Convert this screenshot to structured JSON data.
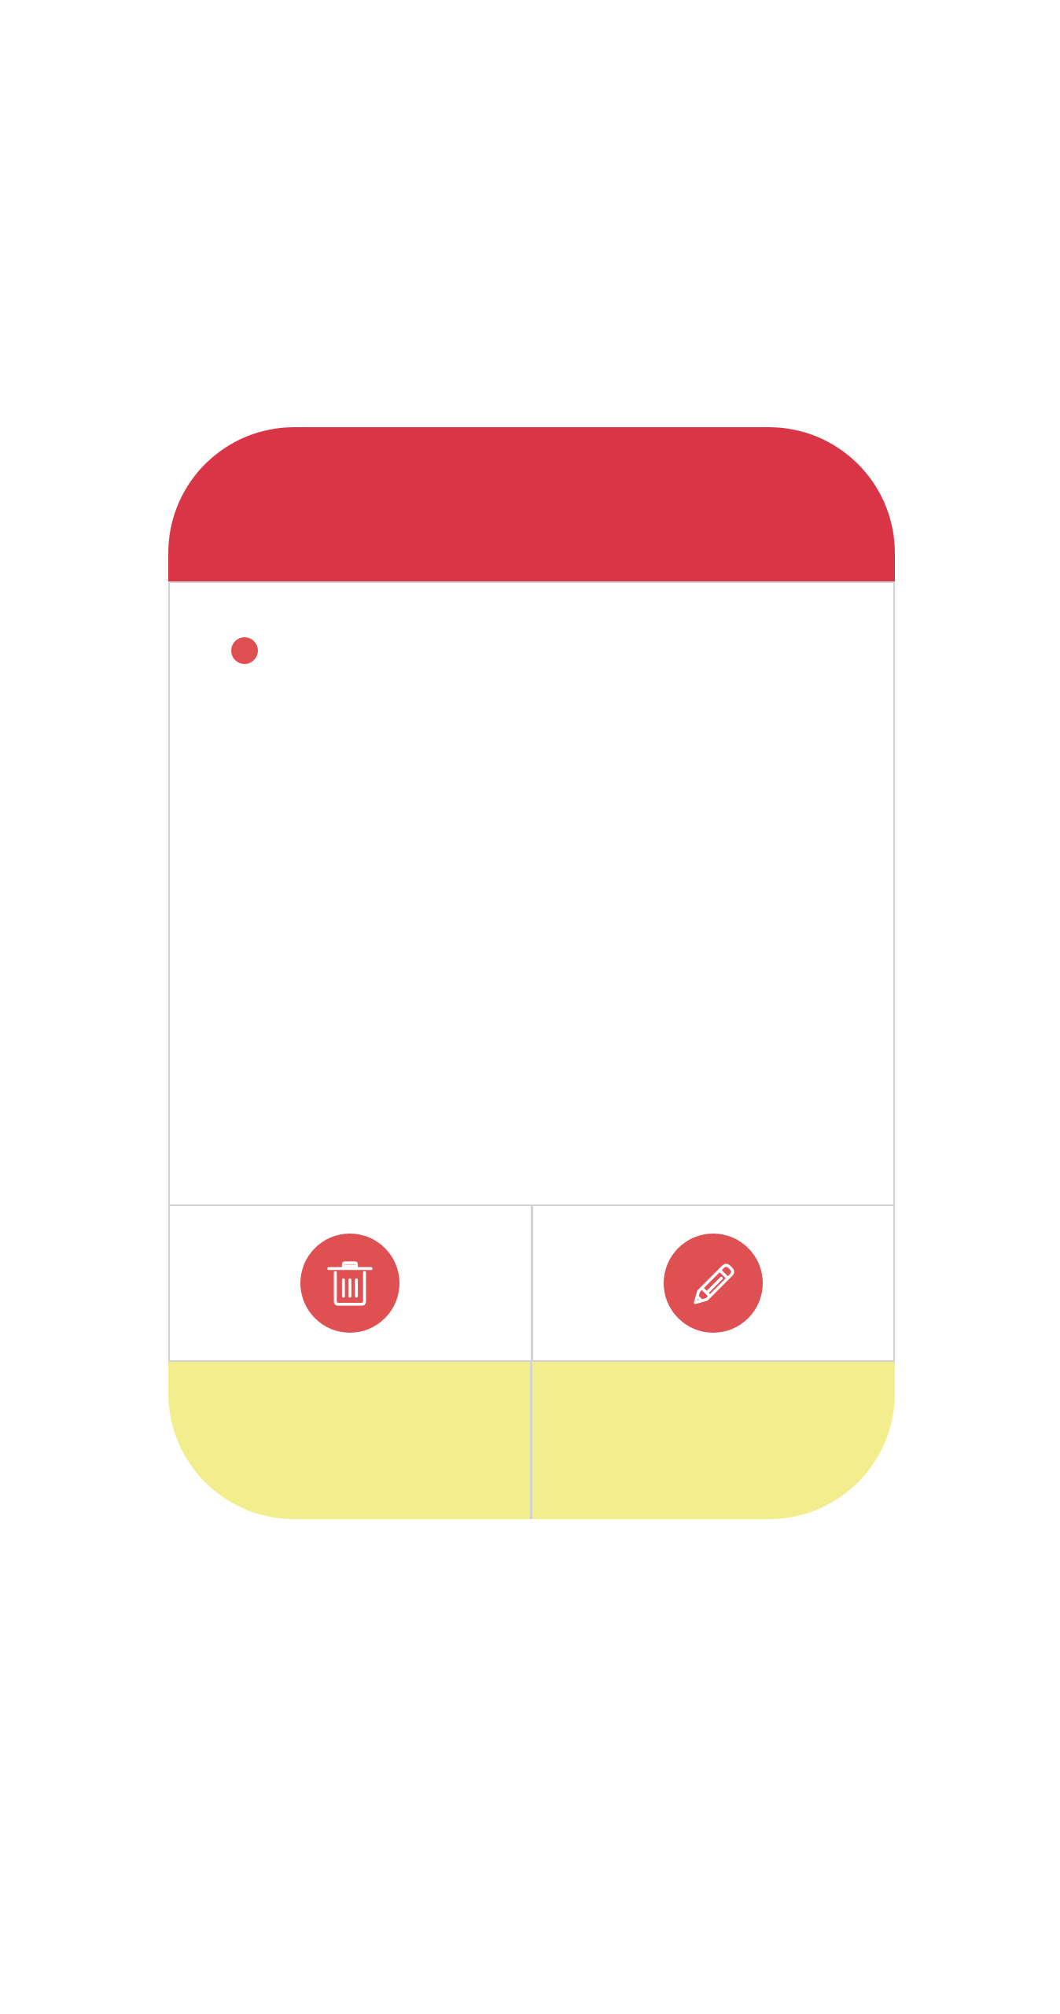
{
  "colors": {
    "header": "#d83646",
    "accent": "#de5052",
    "footer": "#f2ee8e",
    "border": "#d3d3d3"
  },
  "icons": {
    "status": "status-dot-icon",
    "delete": "trash-icon",
    "edit": "pencil-icon"
  }
}
